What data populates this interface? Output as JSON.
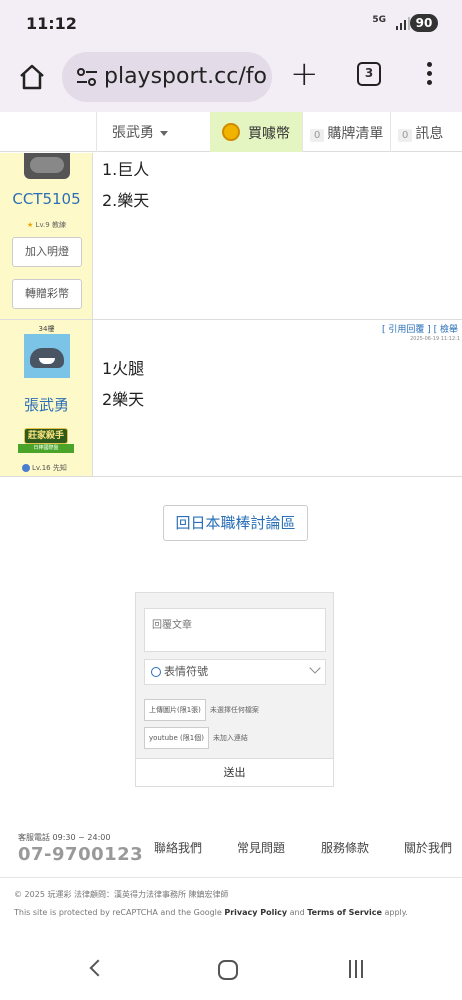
{
  "status": {
    "time": "11:12",
    "network": "5G",
    "battery": "90"
  },
  "browser": {
    "url": "playsport.cc/fo",
    "tab_count": "3"
  },
  "nav": {
    "username": "張武勇",
    "buy_label": "買噱幣",
    "cart_count": "0",
    "cart_label": "購牌清單",
    "msg_count": "0",
    "msg_label": "訊息"
  },
  "posts": [
    {
      "username": "CCT5105",
      "level": "Lv.9 教練",
      "follow_label": "加入明燈",
      "gift_label": "轉贈彩幣",
      "lines": [
        "1.巨人",
        "2.樂天"
      ]
    },
    {
      "floor": "34樓",
      "username": "張武勇",
      "badge_title": "莊家殺手",
      "badge_sub": "日棒國際盤",
      "level": "Lv.16 先知",
      "quote_label": "[ 引用回覆 ]",
      "report_label": "[ 檢舉",
      "timestamp": "2025-06-19 11:12:1",
      "lines": [
        "1火腿",
        "2樂天"
      ]
    }
  ],
  "back_button": "回日本職棒討論區",
  "reply": {
    "placeholder": "回覆文章",
    "emoji_label": "表情符號",
    "upload_image_label": "上傳圖片(限1張)",
    "upload_image_status": "未選擇任何檔案",
    "youtube_label": "youtube (限1個)",
    "youtube_status": "未加入連結",
    "submit_label": "送出"
  },
  "footer": {
    "service_hours": "客服電話 09:30 ~ 24:00",
    "phone": "07-9700123",
    "links": [
      "聯絡我們",
      "常見問題",
      "服務條款",
      "關於我們"
    ],
    "copyright": "© 2025 玩運彩 法律顧問：漢英得力法律事務所 陳鎮宏律師",
    "recaptcha_prefix": "This site is protected by reCAPTCHA and the Google",
    "privacy": "Privacy Policy",
    "and": "and",
    "terms": "Terms of Service",
    "apply": "apply."
  }
}
